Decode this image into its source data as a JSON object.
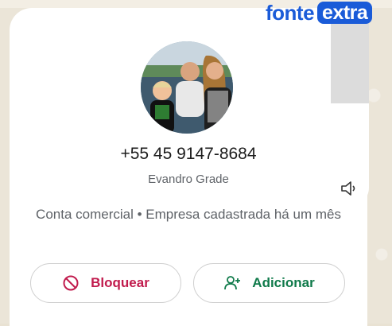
{
  "brand": {
    "logo_part1": "fonte",
    "logo_part2": "extra"
  },
  "contact": {
    "phone": "+55 45 9147-8684",
    "name": "Evandro Grade",
    "description": "Conta comercial • Empresa cadastrada há um mês"
  },
  "actions": {
    "block_label": "Bloquear",
    "add_label": "Adicionar"
  },
  "colors": {
    "block": "#c11b4d",
    "add": "#0f7a4a",
    "logo": "#1a5bd8"
  },
  "icons": [
    "block-icon",
    "add-person-icon",
    "volume-icon",
    "profile-photo"
  ]
}
